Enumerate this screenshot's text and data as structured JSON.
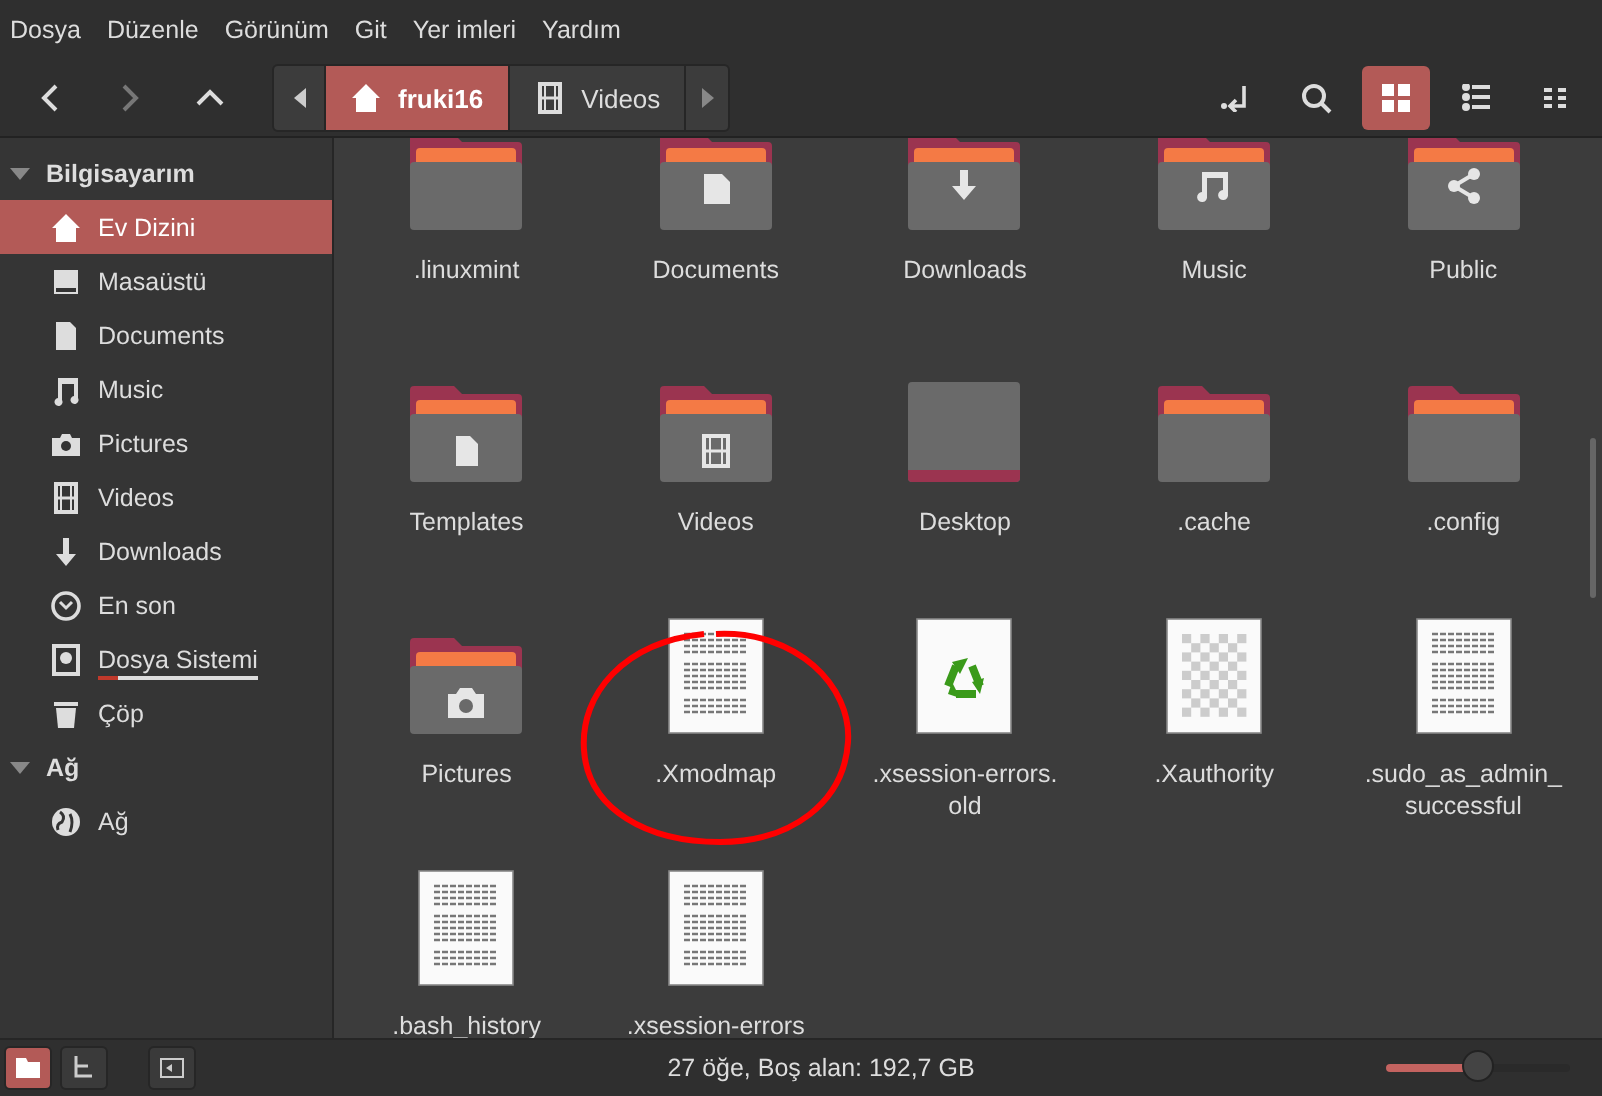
{
  "menu": [
    "Dosya",
    "Düzenle",
    "Görünüm",
    "Git",
    "Yer imleri",
    "Yardım"
  ],
  "breadcrumb": [
    {
      "label": "fruki16",
      "selected": true
    },
    {
      "label": "Videos",
      "selected": false
    }
  ],
  "views": [
    {
      "selected": true
    },
    {
      "selected": false
    },
    {
      "selected": false
    }
  ],
  "sidebar": [
    {
      "title": "Bilgisayarım",
      "expanded": true,
      "items": [
        {
          "label": "Ev Dizini",
          "selected": true
        },
        {
          "label": "Masaüstü",
          "selected": false
        },
        {
          "label": "Documents",
          "selected": false
        },
        {
          "label": "Music",
          "selected": false
        },
        {
          "label": "Pictures",
          "selected": false
        },
        {
          "label": "Videos",
          "selected": false
        },
        {
          "label": "Downloads",
          "selected": false
        },
        {
          "label": "En son",
          "selected": false
        },
        {
          "label": "Dosya Sistemi",
          "selected": false,
          "usage": {
            "level": 0.12
          }
        },
        {
          "label": "Çöp",
          "selected": false
        }
      ]
    },
    {
      "title": "Ağ",
      "expanded": true,
      "items": [
        {
          "label": "Ağ",
          "selected": false
        }
      ]
    }
  ],
  "files": [
    {
      "name": ".linuxmint",
      "kind": "folder",
      "circled": false
    },
    {
      "name": "Documents",
      "kind": "documents",
      "circled": false
    },
    {
      "name": "Downloads",
      "kind": "downloads",
      "circled": false
    },
    {
      "name": "Music",
      "kind": "music",
      "circled": false
    },
    {
      "name": "Public",
      "kind": "public",
      "circled": false
    },
    {
      "name": "Templates",
      "kind": "templates",
      "circled": false
    },
    {
      "name": "Videos",
      "kind": "videos",
      "circled": false
    },
    {
      "name": "Desktop",
      "kind": "desktop",
      "circled": false
    },
    {
      "name": ".cache",
      "kind": "folder",
      "circled": false
    },
    {
      "name": ".config",
      "kind": "folder",
      "circled": false
    },
    {
      "name": "Pictures",
      "kind": "pictures",
      "circled": false
    },
    {
      "name": ".Xmodmap",
      "kind": "text",
      "circled": true
    },
    {
      "name": ".xsession-errors.\nold",
      "kind": "recycle",
      "circled": false
    },
    {
      "name": ".Xauthority",
      "kind": "checker",
      "circled": false
    },
    {
      "name": ".sudo_as_admin_\nsuccessful",
      "kind": "text",
      "circled": false
    },
    {
      "name": ".bash_history",
      "kind": "text",
      "circled": false
    },
    {
      "name": ".xsession-errors",
      "kind": "text",
      "circled": false
    }
  ],
  "status_buttons": [
    {
      "selected": true
    },
    {
      "selected": false
    },
    {
      "selected": false
    }
  ],
  "status": "27 öğe, Boş alan: 192,7 GB",
  "zoom": {
    "level": 0.5
  }
}
